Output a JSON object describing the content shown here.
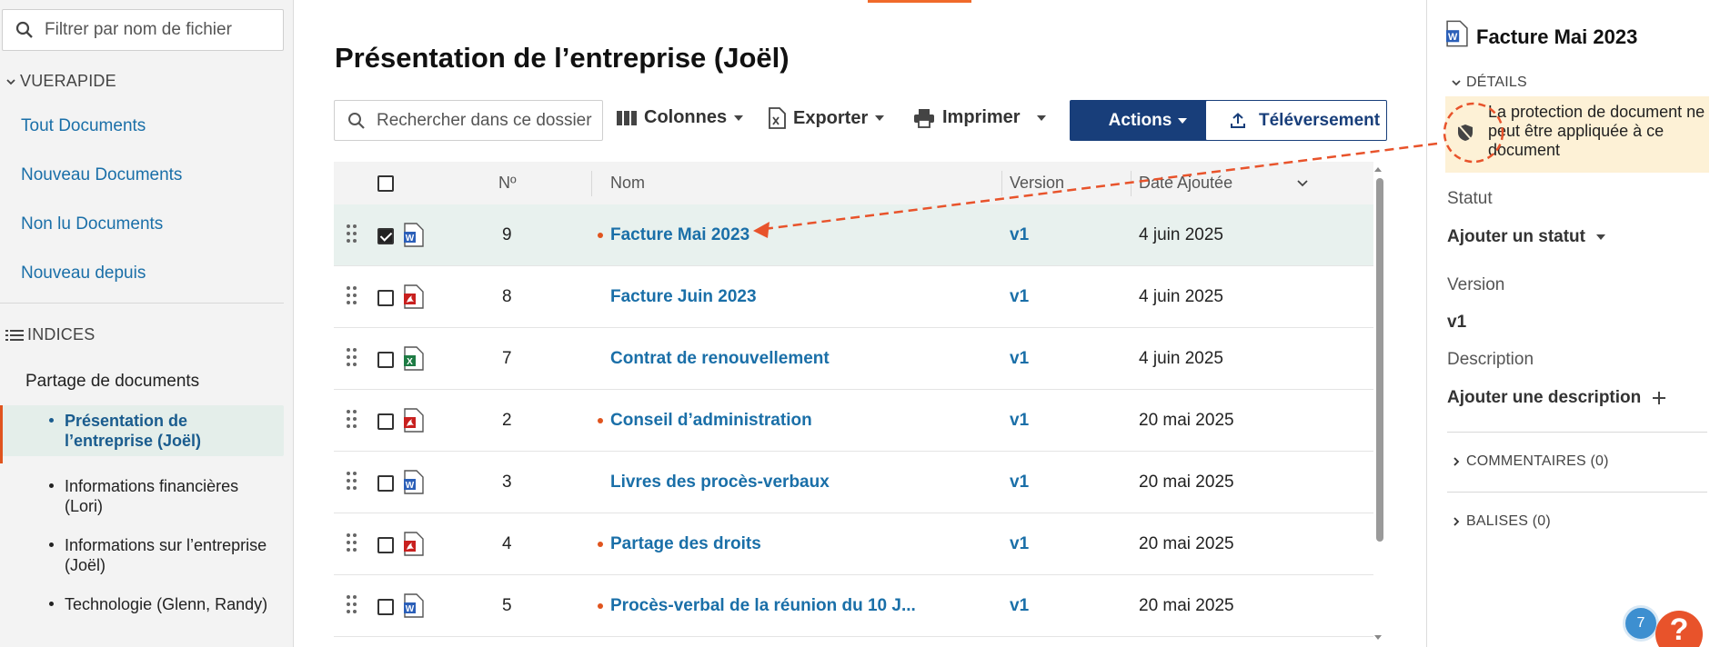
{
  "sidebar": {
    "filter_placeholder": "Filtrer par nom de fichier",
    "quick_view": {
      "heading": "VUERAPIDE",
      "links": [
        "Tout Documents",
        "Nouveau Documents",
        "Non lu Documents",
        "Nouveau depuis"
      ]
    },
    "indices": {
      "heading": "INDICES",
      "root": "Partage de documents",
      "items": [
        {
          "label": "Présentation de l’entreprise (Joël)",
          "active": true
        },
        {
          "label": "Informations financières (Lori)",
          "active": false
        },
        {
          "label": "Informations sur l’entreprise (Joël)",
          "active": false
        },
        {
          "label": "Technologie (Glenn, Randy)",
          "active": false
        }
      ]
    }
  },
  "main": {
    "title": "Présentation de l’entreprise (Joël)",
    "search_placeholder": "Rechercher dans ce dossier",
    "toolbar": {
      "columns": "Colonnes",
      "export": "Exporter",
      "print": "Imprimer",
      "actions": "Actions",
      "upload": "Téléversement"
    },
    "table": {
      "headers": {
        "number": "Nº",
        "name": "Nom",
        "version": "Version",
        "date": "Date Ajoutée"
      },
      "rows": [
        {
          "num": "9",
          "name": "Facture Mai 2023",
          "version": "v1",
          "date": "4 juin 2025",
          "type": "word",
          "unread": true,
          "selected": true
        },
        {
          "num": "8",
          "name": "Facture Juin 2023",
          "version": "v1",
          "date": "4 juin 2025",
          "type": "pdf",
          "unread": false,
          "selected": false
        },
        {
          "num": "7",
          "name": "Contrat de renouvellement",
          "version": "v1",
          "date": "4 juin 2025",
          "type": "excel",
          "unread": false,
          "selected": false
        },
        {
          "num": "2",
          "name": "Conseil d’administration",
          "version": "v1",
          "date": "20 mai 2025",
          "type": "pdf",
          "unread": true,
          "selected": false
        },
        {
          "num": "3",
          "name": "Livres des procès-verbaux",
          "version": "v1",
          "date": "20 mai 2025",
          "type": "word",
          "unread": false,
          "selected": false
        },
        {
          "num": "4",
          "name": "Partage des droits",
          "version": "v1",
          "date": "20 mai 2025",
          "type": "pdf",
          "unread": true,
          "selected": false
        },
        {
          "num": "5",
          "name": "Procès-verbal de la réunion du 10 J...",
          "version": "v1",
          "date": "20 mai 2025",
          "type": "word",
          "unread": true,
          "selected": false
        }
      ]
    }
  },
  "details": {
    "title": "Facture Mai 2023",
    "details_heading": "DÉTAILS",
    "warning": "La protection de document ne peut être appliquée à ce document",
    "status_label": "Statut",
    "status_value": "Ajouter un statut",
    "version_label": "Version",
    "version_value": "v1",
    "description_label": "Description",
    "description_value": "Ajouter une description",
    "comments_heading": "COMMENTAIRES (0)",
    "tags_heading": "BALISES (0)"
  },
  "badge_count": "7",
  "help_label": "?",
  "colors": {
    "accent": "#e0541e",
    "primary": "#183e7a",
    "link": "#1a6fa8",
    "warning_bg": "#fdf1d6"
  }
}
